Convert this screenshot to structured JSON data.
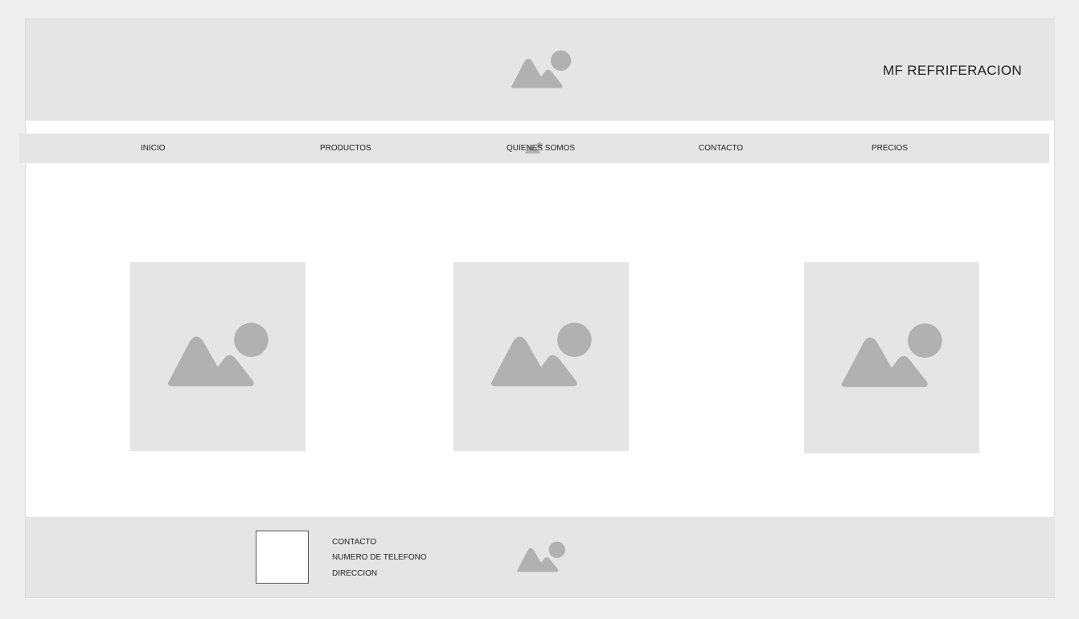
{
  "header": {
    "site_title": "MF REFRIFERACION"
  },
  "nav": {
    "items": [
      {
        "label": "INICIO"
      },
      {
        "label": "PRODUCTOS"
      },
      {
        "label": "QUIENES SOMOS"
      },
      {
        "label": "CONTACTO"
      },
      {
        "label": "PRECIOS"
      }
    ]
  },
  "footer": {
    "contact_label": "CONTACTO",
    "phone_label": "NUMERO DE TELEFONO",
    "address_label": "DIRECCION"
  },
  "icons": {
    "placeholder_image": "image-placeholder-icon"
  },
  "colors": {
    "background": "#eeeeee",
    "panel": "#e5e5e5",
    "placeholder_icon": "#b1b1b1",
    "text": "#222222"
  }
}
